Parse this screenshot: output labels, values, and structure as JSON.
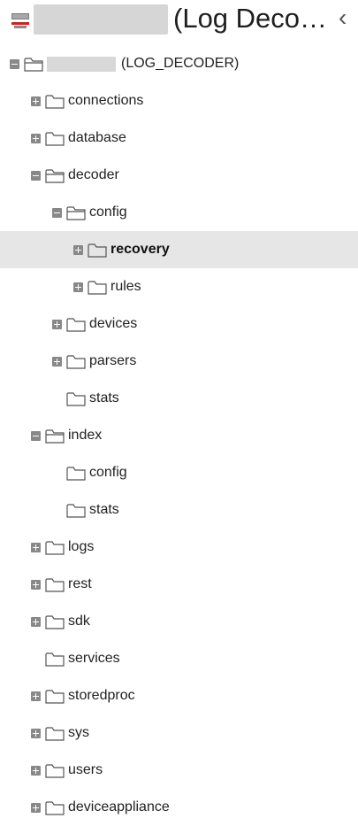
{
  "header": {
    "title": "(Log Deco…",
    "app_icon": "server-icon",
    "collapse_icon": "chevron-left-icon",
    "redacted_name": ""
  },
  "root": {
    "label": "(LOG_DECODER)",
    "state": "expanded"
  },
  "tree": [
    {
      "label": "connections",
      "toggle": "plus"
    },
    {
      "label": "database",
      "toggle": "plus"
    },
    {
      "label": "decoder",
      "toggle": "minus"
    },
    {
      "label": "config",
      "toggle": "minus"
    },
    {
      "label": "recovery",
      "toggle": "plus",
      "selected": true
    },
    {
      "label": "rules",
      "toggle": "plus"
    },
    {
      "label": "devices",
      "toggle": "plus"
    },
    {
      "label": "parsers",
      "toggle": "plus"
    },
    {
      "label": "stats",
      "toggle": "none"
    },
    {
      "label": "index",
      "toggle": "minus"
    },
    {
      "label": "config",
      "toggle": "none"
    },
    {
      "label": "stats",
      "toggle": "none"
    },
    {
      "label": "logs",
      "toggle": "plus"
    },
    {
      "label": "rest",
      "toggle": "plus"
    },
    {
      "label": "sdk",
      "toggle": "plus"
    },
    {
      "label": "services",
      "toggle": "none"
    },
    {
      "label": "storedproc",
      "toggle": "plus"
    },
    {
      "label": "sys",
      "toggle": "plus"
    },
    {
      "label": "users",
      "toggle": "plus"
    },
    {
      "label": "deviceappliance",
      "toggle": "plus"
    }
  ],
  "colors": {
    "selected_row": "#e6e6e6",
    "toggle": "#888888",
    "folder_stroke": "#555555",
    "app_icon_red": "#cc2222"
  }
}
